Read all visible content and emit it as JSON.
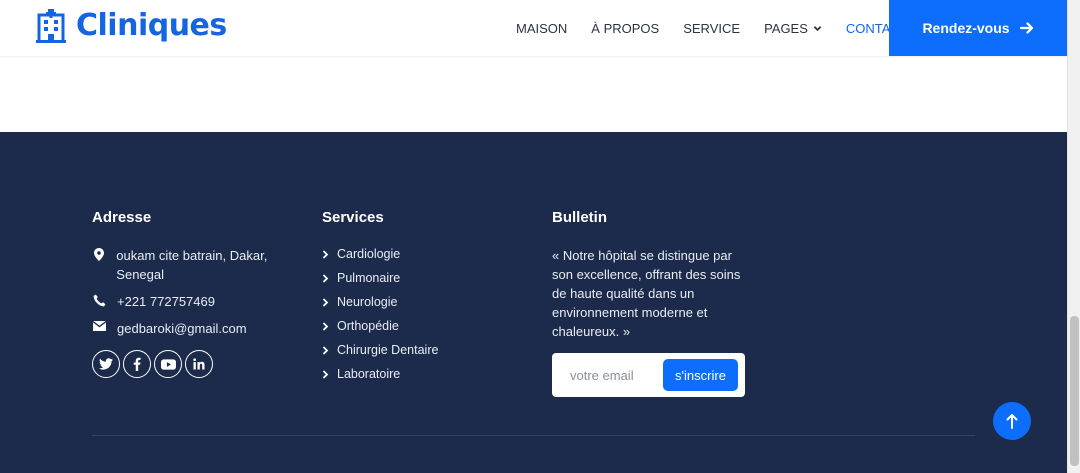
{
  "header": {
    "brand": "Cliniques",
    "nav": [
      {
        "label": "MAISON"
      },
      {
        "label": "À PROPOS"
      },
      {
        "label": "SERVICE"
      },
      {
        "label": "PAGES"
      },
      {
        "label": "CONTACT"
      }
    ],
    "cta_label": "Rendez-vous"
  },
  "footer": {
    "address": {
      "title": "Adresse",
      "location": "oukam cite batrain, Dakar, Senegal",
      "phone": "+221 772757469",
      "email": "gedbaroki@gmail.com"
    },
    "socials": [
      "twitter-icon",
      "facebook-icon",
      "youtube-icon",
      "linkedin-icon"
    ],
    "services": {
      "title": "Services",
      "items": [
        "Cardiologie",
        "Pulmonaire",
        "Neurologie",
        "Orthopédie",
        "Chirurgie Dentaire",
        "Laboratoire"
      ]
    },
    "bulletin": {
      "title": "Bulletin",
      "text": "« Notre hôpital se distingue par son excellence, offrant des soins de haute qualité dans un environnement moderne et chaleureux. »",
      "email_placeholder": "votre email",
      "subscribe_label": "s'inscrire"
    }
  },
  "colors": {
    "brand": "#1565e0",
    "accent": "#0d6efd",
    "footer_bg": "#1c2a4b"
  }
}
